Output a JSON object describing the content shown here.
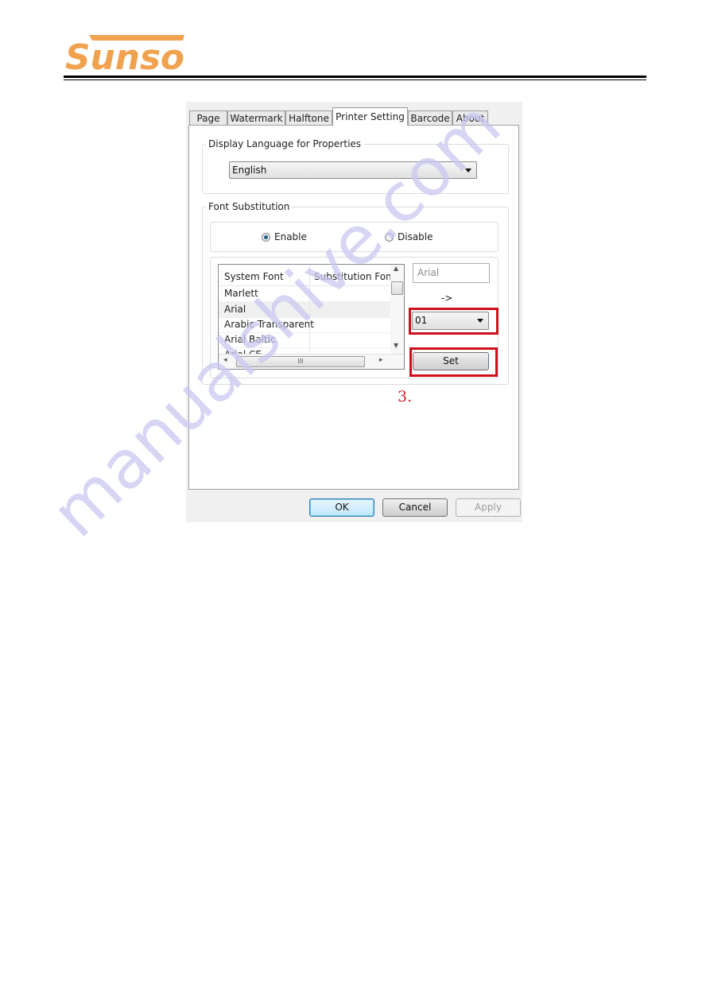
{
  "header": {
    "brand": "Sunso",
    "brand_color": "#f0a24f"
  },
  "dialog": {
    "tabs": [
      {
        "label": "Page",
        "active": false
      },
      {
        "label": "Watermark",
        "active": false
      },
      {
        "label": "Halftone",
        "active": false
      },
      {
        "label": "Printer Setting",
        "active": true
      },
      {
        "label": "Barcode",
        "active": false
      },
      {
        "label": "About",
        "active": false
      }
    ],
    "display_language": {
      "legend": "Display Language for Properties",
      "selected": "English"
    },
    "font_substitution": {
      "legend": "Font Substitution",
      "enable_label": "Enable",
      "disable_label": "Disable",
      "selected": "Enable",
      "columns": [
        "System Font",
        "Substitution Font"
      ],
      "rows": [
        {
          "system": "Marlett",
          "substitution": ""
        },
        {
          "system": "Arial",
          "substitution": "",
          "selected": true
        },
        {
          "system": "Arabic Transparent",
          "substitution": ""
        },
        {
          "system": "Arial Baltic",
          "substitution": ""
        },
        {
          "system": "Arial CE",
          "substitution": ""
        }
      ],
      "current_font": "Arial",
      "arrow_text": "->",
      "substitution_value": "01",
      "set_label": "Set"
    },
    "buttons": {
      "ok": "OK",
      "cancel": "Cancel",
      "apply": "Apply"
    }
  },
  "annotation": {
    "step_label": "3.",
    "highlight_color": "#d10f1b"
  },
  "watermark": "manualshive.com"
}
